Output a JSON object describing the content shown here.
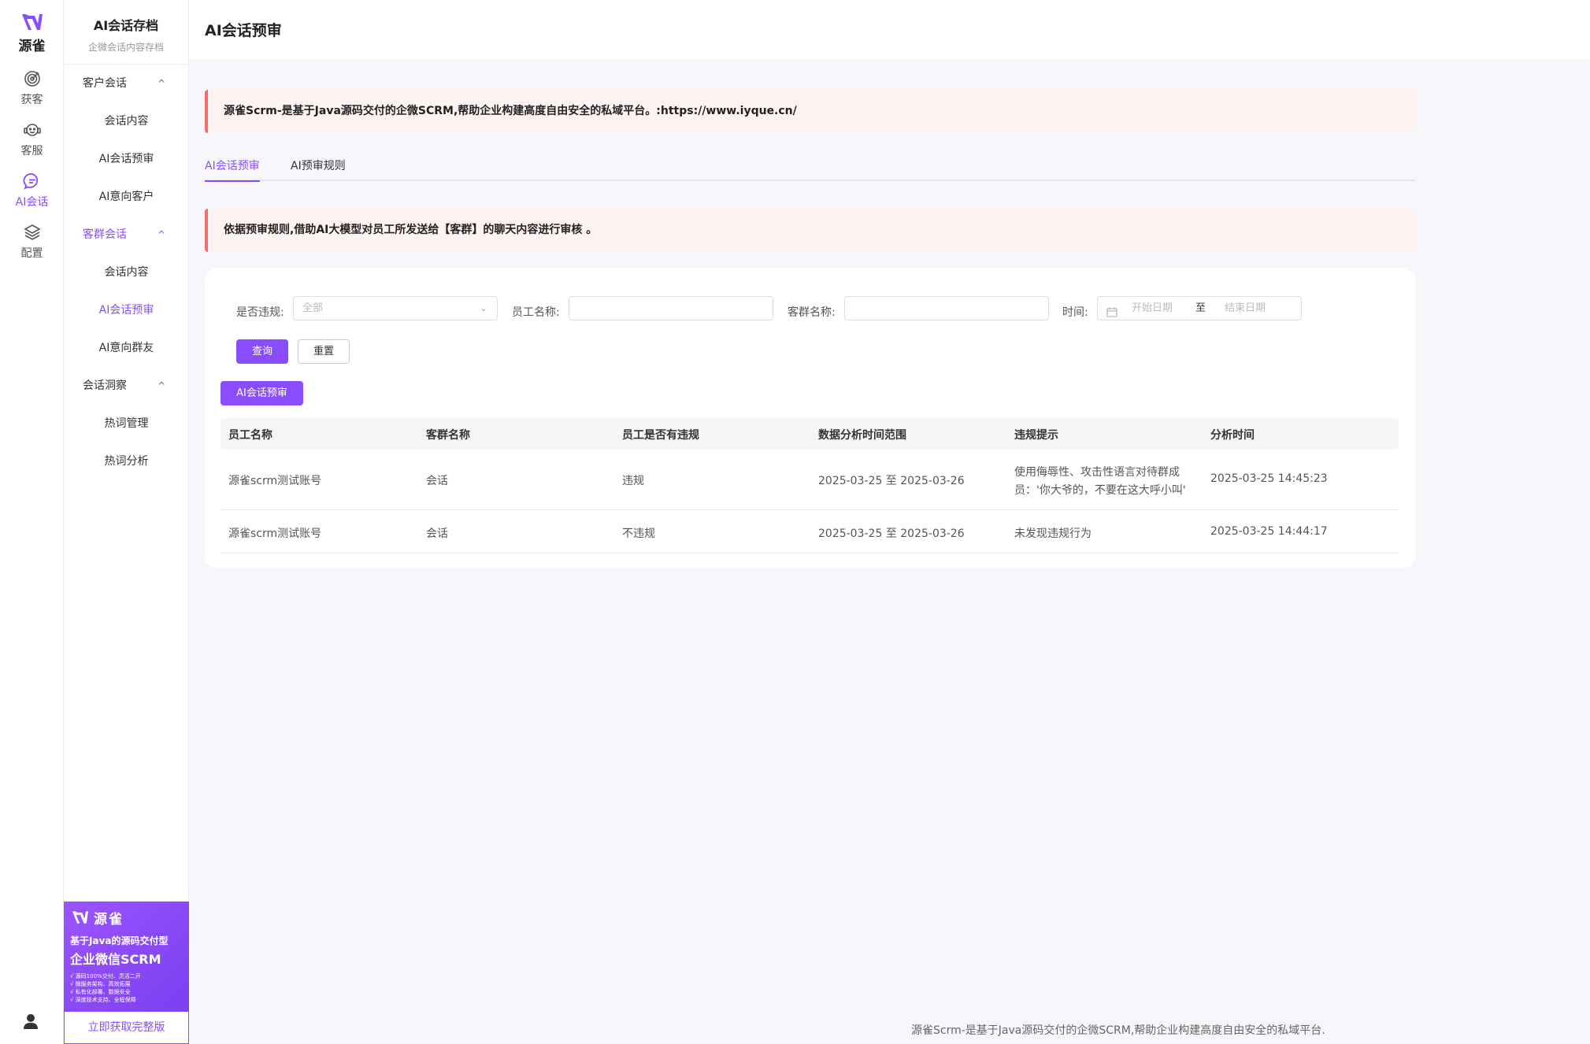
{
  "brand": {
    "name": "源雀"
  },
  "rail": {
    "items": [
      {
        "label": "获客",
        "icon": "target-icon"
      },
      {
        "label": "客服",
        "icon": "headset-icon"
      },
      {
        "label": "AI会话",
        "icon": "chat-icon",
        "active": true
      },
      {
        "label": "配置",
        "icon": "layers-icon"
      }
    ]
  },
  "sidebar": {
    "title": "AI会话存档",
    "subtitle": "企微会话内容存档",
    "groups": [
      {
        "label": "客户会话",
        "chevron": "^",
        "items": [
          "会话内容",
          "AI会话预审",
          "AI意向客户"
        ]
      },
      {
        "label": "客群会话",
        "chevron": "^",
        "items": [
          "会话内容",
          "AI会话预审",
          "AI意向群友"
        ]
      },
      {
        "label": "会话洞察",
        "chevron": "^",
        "items": [
          "热词管理",
          "热词分析"
        ]
      }
    ],
    "active_group": "客群会话",
    "active_item": "AI会话预审"
  },
  "promo": {
    "brand": "源雀",
    "line1": "基于Java的源码交付型",
    "line2": "企业微信SCRM",
    "bullets": [
      "√ 源码100%交付、灵活二开",
      "√ 微服务架构、高效拓展",
      "√ 私有化部署、数据安全",
      "√ 深度技术支持、全程保障"
    ],
    "button": "立即获取完整版"
  },
  "header": {
    "title": "AI会话预审"
  },
  "banner_top": "源雀Scrm-是基于Java源码交付的企微SCRM,帮助企业构建高度自由安全的私域平台。:https://www.iyque.cn/",
  "tabs": [
    {
      "label": "AI会话预审",
      "active": true
    },
    {
      "label": "AI预审规则",
      "active": false
    }
  ],
  "banner_rule": "依据预审规则,借助AI大模型对员工所发送给【客群】的聊天内容进行审核 。",
  "filters": {
    "violation_label": "是否违规:",
    "violation_value": "全部",
    "employee_label": "员工名称:",
    "employee_value": "",
    "group_label": "客群名称:",
    "group_value": "",
    "time_label": "时间:",
    "start_placeholder": "开始日期",
    "range_sep": "至",
    "end_placeholder": "结束日期",
    "query_button": "查询",
    "reset_button": "重置",
    "review_button": "AI会话预审"
  },
  "table": {
    "columns": [
      "员工名称",
      "客群名称",
      "员工是否有违规",
      "数据分析时间范围",
      "违规提示",
      "分析时间"
    ],
    "rows": [
      [
        "源雀scrm测试账号",
        "会话",
        "违规",
        "2025-03-25 至 2025-03-26",
        "使用侮辱性、攻击性语言对待群成员：'你大爷的，不要在这大呼小叫'",
        "2025-03-25 14:45:23"
      ],
      [
        "源雀scrm测试账号",
        "会话",
        "不违规",
        "2025-03-25 至 2025-03-26",
        "未发现违规行为",
        "2025-03-25 14:44:17"
      ]
    ]
  },
  "footer": "源雀Scrm-是基于Java源码交付的企微SCRM,帮助企业构建高度自由安全的私域平台.",
  "colors": {
    "accent": "#8a4dfd",
    "warning_border": "#f56c6c",
    "banner_bg": "#fef3f3"
  }
}
